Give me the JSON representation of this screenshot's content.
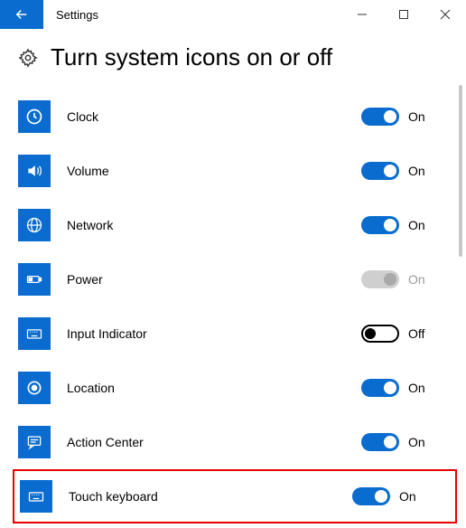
{
  "window": {
    "title": "Settings"
  },
  "page": {
    "heading": "Turn system icons on or off"
  },
  "state_labels": {
    "on": "On",
    "off": "Off"
  },
  "items": [
    {
      "id": "clock",
      "label": "Clock",
      "state": "on",
      "state_text": "On",
      "highlighted": false
    },
    {
      "id": "volume",
      "label": "Volume",
      "state": "on",
      "state_text": "On",
      "highlighted": false
    },
    {
      "id": "network",
      "label": "Network",
      "state": "on",
      "state_text": "On",
      "highlighted": false
    },
    {
      "id": "power",
      "label": "Power",
      "state": "disabled",
      "state_text": "On",
      "highlighted": false
    },
    {
      "id": "input-indicator",
      "label": "Input Indicator",
      "state": "off",
      "state_text": "Off",
      "highlighted": false
    },
    {
      "id": "location",
      "label": "Location",
      "state": "on",
      "state_text": "On",
      "highlighted": false
    },
    {
      "id": "action-center",
      "label": "Action Center",
      "state": "on",
      "state_text": "On",
      "highlighted": false
    },
    {
      "id": "touch-keyboard",
      "label": "Touch keyboard",
      "state": "on",
      "state_text": "On",
      "highlighted": true
    }
  ],
  "icons": {
    "clock": "clock-icon",
    "volume": "volume-icon",
    "network": "globe-icon",
    "power": "battery-icon",
    "input-indicator": "keyboard-icon",
    "location": "location-icon",
    "action-center": "action-center-icon",
    "touch-keyboard": "keyboard-icon"
  }
}
